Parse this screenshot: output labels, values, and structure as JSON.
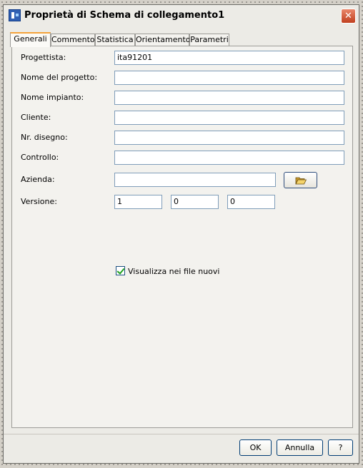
{
  "window": {
    "title": "Proprietà di Schema di collegamento1",
    "close_glyph": "✕"
  },
  "tabs": [
    {
      "label": "Generali",
      "active": true
    },
    {
      "label": "Commento",
      "active": false
    },
    {
      "label": "Statistica",
      "active": false
    },
    {
      "label": "Orientamento",
      "active": false
    },
    {
      "label": "Parametri",
      "active": false
    }
  ],
  "form": {
    "fields": [
      {
        "label": "Progettista:",
        "value": "ita91201"
      },
      {
        "label": "Nome del progetto:",
        "value": ""
      },
      {
        "label": "Nome impianto:",
        "value": ""
      },
      {
        "label": "Cliente:",
        "value": ""
      },
      {
        "label": "Nr. disegno:",
        "value": ""
      },
      {
        "label": "Controllo:",
        "value": ""
      },
      {
        "label": "Azienda:",
        "value": ""
      }
    ],
    "version": {
      "label": "Versione:",
      "major": "1",
      "minor": "0",
      "patch": "0"
    },
    "browse_icon": "open-folder-icon",
    "show_in_new_files": {
      "label": "Visualizza nei file nuovi",
      "checked": true
    }
  },
  "buttons": {
    "ok": "OK",
    "cancel": "Annulla",
    "help": "?"
  }
}
